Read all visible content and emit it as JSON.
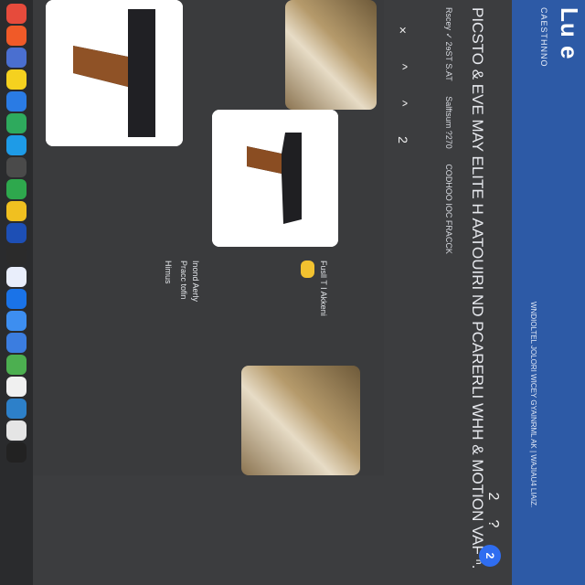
{
  "header": {
    "brand": "Lu e",
    "site": "CAESTHNNO",
    "meta_left": "Rscey   ✓ 2ɘST S.AT",
    "meta_right": "WNDIOLTEL JOLORI  WICEY GYAINRML  AK  |  WAJIAU4 LIAIZ.",
    "meta_sub1": "Salftsum  ?270",
    "meta_sub2": "CODHOO IOC FRACCK"
  },
  "page": {
    "heading": "PICSTO & EVE MAY ELITE H AATOUIRI ND PCARERLI WHH & MOTION VAF ⁿ.",
    "back_label": "×"
  },
  "controls": {
    "top": "2",
    "bottom": "?",
    "fab": "2",
    "left1": "^",
    "left2": "^",
    "left3": "2"
  },
  "cards": {
    "card1_title": "Fusll T I Akkeni",
    "card1_badge": "",
    "card2_title": "Inond Aerly",
    "card2_sub": "Pracc tofin",
    "card3_title": "Himus"
  },
  "dock": {
    "icons": [
      "browser-icon",
      "mail-icon",
      "files-icon",
      "notes-icon",
      "calendar-icon",
      "maps-icon",
      "app-store-icon",
      "settings-icon",
      "camera-icon",
      "photos-icon",
      "music-icon",
      "ad-icon",
      "chat-icon",
      "chrome-icon",
      "edge-icon",
      "messages-icon",
      "drive-icon",
      "video-icon",
      "globe-icon",
      "aol-icon",
      "gallery-icon"
    ],
    "colors": [
      "#e64b3c",
      "#f05a28",
      "#4a6fd0",
      "#f5d11f",
      "#2a7be4",
      "#2eaa5d",
      "#1e9be7",
      "#4a4a4a",
      "#2ea84d",
      "#f0c020",
      "#1d4fb5",
      "#2b2b2b",
      "#e9eefb",
      "#1a73e8",
      "#3d8ef0",
      "#3b7de0",
      "#4caf50",
      "#f0f0f0",
      "#2d80c9",
      "#e5e5e5",
      "#222222"
    ]
  }
}
